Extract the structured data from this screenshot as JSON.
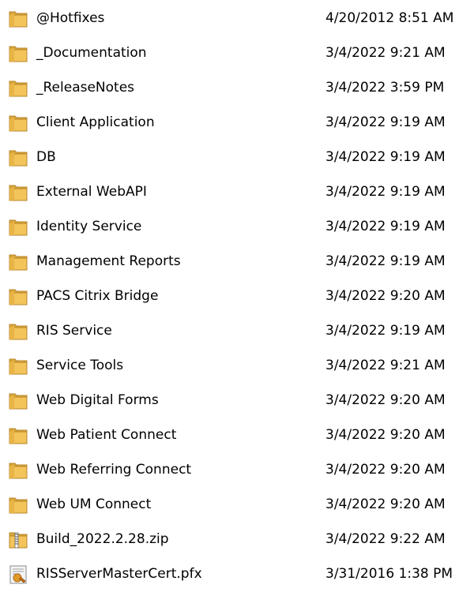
{
  "files": [
    {
      "name": "@Hotfixes",
      "modified": "4/20/2012 8:51 AM",
      "icon": "folder-icon"
    },
    {
      "name": "_Documentation",
      "modified": "3/4/2022 9:21 AM",
      "icon": "folder-icon"
    },
    {
      "name": "_ReleaseNotes",
      "modified": "3/4/2022 3:59 PM",
      "icon": "folder-icon"
    },
    {
      "name": "Client Application",
      "modified": "3/4/2022 9:19 AM",
      "icon": "folder-icon"
    },
    {
      "name": "DB",
      "modified": "3/4/2022 9:19 AM",
      "icon": "folder-icon"
    },
    {
      "name": "External WebAPI",
      "modified": "3/4/2022 9:19 AM",
      "icon": "folder-icon"
    },
    {
      "name": "Identity Service",
      "modified": "3/4/2022 9:19 AM",
      "icon": "folder-icon"
    },
    {
      "name": "Management Reports",
      "modified": "3/4/2022 9:19 AM",
      "icon": "folder-icon"
    },
    {
      "name": "PACS Citrix Bridge",
      "modified": "3/4/2022 9:20 AM",
      "icon": "folder-icon"
    },
    {
      "name": "RIS Service",
      "modified": "3/4/2022 9:19 AM",
      "icon": "folder-icon"
    },
    {
      "name": "Service Tools",
      "modified": "3/4/2022 9:21 AM",
      "icon": "folder-icon"
    },
    {
      "name": "Web Digital Forms",
      "modified": "3/4/2022 9:20 AM",
      "icon": "folder-icon"
    },
    {
      "name": "Web Patient Connect",
      "modified": "3/4/2022 9:20 AM",
      "icon": "folder-icon"
    },
    {
      "name": "Web Referring Connect",
      "modified": "3/4/2022 9:20 AM",
      "icon": "folder-icon"
    },
    {
      "name": "Web UM Connect",
      "modified": "3/4/2022 9:20 AM",
      "icon": "folder-icon"
    },
    {
      "name": "Build_2022.2.28.zip",
      "modified": "3/4/2022 9:22 AM",
      "icon": "zip-archive-icon"
    },
    {
      "name": "RISServerMasterCert.pfx",
      "modified": "3/31/2016 1:38 PM",
      "icon": "certificate-icon"
    }
  ],
  "colors": {
    "folder_front": "#f2c45a",
    "folder_back": "#d9a63a",
    "folder_edge": "#b8862a",
    "zip_stripe": "#6a6a6a",
    "cert_seal": "#e09a2a"
  }
}
